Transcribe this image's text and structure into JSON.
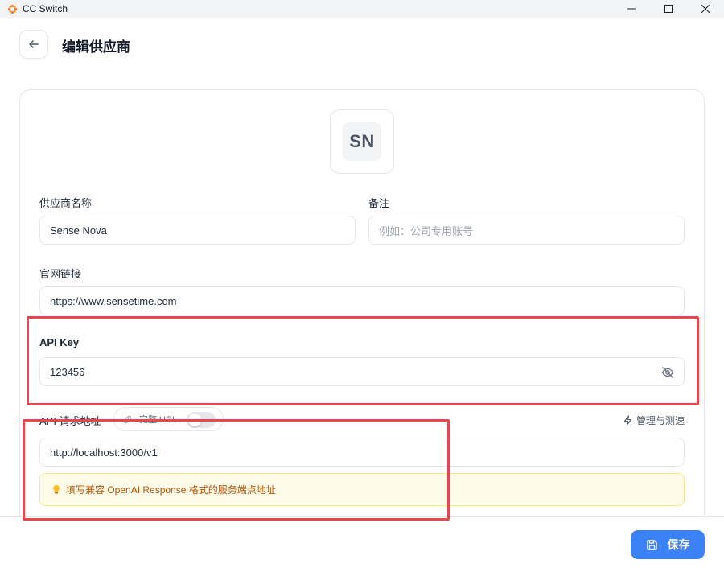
{
  "window": {
    "title": "CC Switch",
    "controls": {
      "minimize": "—",
      "maximize": "☐",
      "close": "✕"
    }
  },
  "header": {
    "title": "编辑供应商"
  },
  "provider": {
    "avatar_initials": "SN"
  },
  "form": {
    "name_label": "供应商名称",
    "name_value": "Sense Nova",
    "note_label": "备注",
    "note_placeholder": "例如：公司专用账号",
    "website_label": "官网链接",
    "website_value": "https://www.sensetime.com",
    "api_key_label": "API Key",
    "api_key_value": "123456",
    "api_url_label": "API 请求地址",
    "full_url_toggle_label": "完整 URL",
    "full_url_enabled": false,
    "manage_link_label": "管理与测速",
    "api_url_value": "http://localhost:3000/v1",
    "hint_text": "填写兼容 OpenAI Response 格式的服务端点地址"
  },
  "footer": {
    "save_label": "保存"
  },
  "colors": {
    "accent": "#3b82f6",
    "annotation": "#e8454f",
    "hint_bg": "#fefce8",
    "hint_text": "#b45309"
  }
}
